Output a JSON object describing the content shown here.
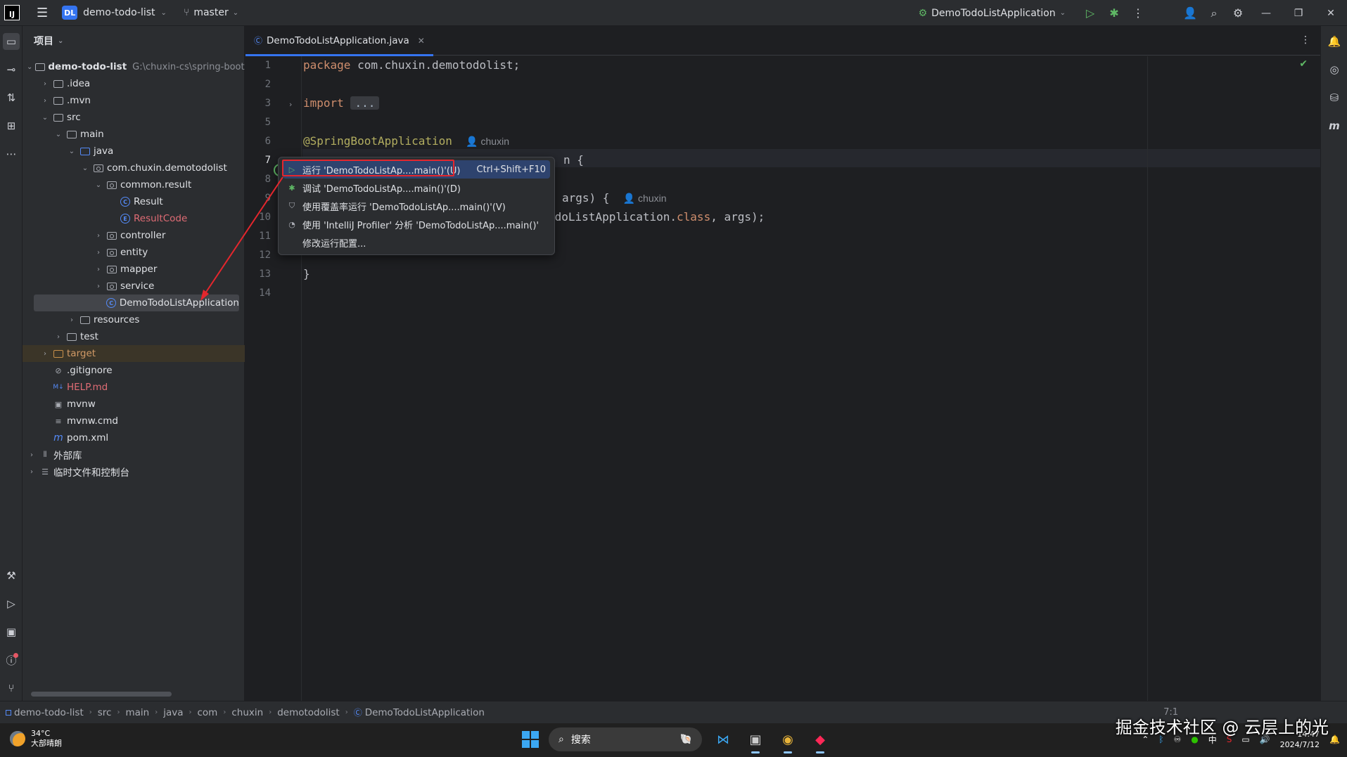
{
  "titlebar": {
    "project_badge": "DL",
    "project_name": "demo-todo-list",
    "branch": "master",
    "run_config": "DemoTodoListApplication"
  },
  "project_panel": {
    "title": "项目",
    "root": "demo-todo-list",
    "root_path": "G:\\chuxin-cs\\spring-boot-",
    "tree": [
      {
        "label": ".idea",
        "depth": 1,
        "arrow": ">",
        "icon": "folder"
      },
      {
        "label": ".mvn",
        "depth": 1,
        "arrow": ">",
        "icon": "folder"
      },
      {
        "label": "src",
        "depth": 1,
        "arrow": "v",
        "icon": "folder"
      },
      {
        "label": "main",
        "depth": 2,
        "arrow": "v",
        "icon": "folder"
      },
      {
        "label": "java",
        "depth": 3,
        "arrow": "v",
        "icon": "folder-blue"
      },
      {
        "label": "com.chuxin.demotodolist",
        "depth": 4,
        "arrow": "v",
        "icon": "package"
      },
      {
        "label": "common.result",
        "depth": 5,
        "arrow": "v",
        "icon": "package"
      },
      {
        "label": "Result",
        "depth": 6,
        "arrow": "",
        "icon": "class"
      },
      {
        "label": "ResultCode",
        "depth": 6,
        "arrow": "",
        "icon": "enum"
      },
      {
        "label": "controller",
        "depth": 5,
        "arrow": ">",
        "icon": "package"
      },
      {
        "label": "entity",
        "depth": 5,
        "arrow": ">",
        "icon": "package"
      },
      {
        "label": "mapper",
        "depth": 5,
        "arrow": ">",
        "icon": "package"
      },
      {
        "label": "service",
        "depth": 5,
        "arrow": ">",
        "icon": "package"
      },
      {
        "label": "DemoTodoListApplication",
        "depth": 5,
        "arrow": "",
        "icon": "spring-class"
      },
      {
        "label": "resources",
        "depth": 3,
        "arrow": ">",
        "icon": "folder"
      },
      {
        "label": "test",
        "depth": 2,
        "arrow": ">",
        "icon": "folder"
      },
      {
        "label": "target",
        "depth": 1,
        "arrow": ">",
        "icon": "folder-orange"
      },
      {
        "label": ".gitignore",
        "depth": 1,
        "arrow": "",
        "icon": "ignore"
      },
      {
        "label": "HELP.md",
        "depth": 1,
        "arrow": "",
        "icon": "markdown"
      },
      {
        "label": "mvnw",
        "depth": 1,
        "arrow": "",
        "icon": "terminal"
      },
      {
        "label": "mvnw.cmd",
        "depth": 1,
        "arrow": "",
        "icon": "text"
      },
      {
        "label": "pom.xml",
        "depth": 1,
        "arrow": "",
        "icon": "maven"
      },
      {
        "label": "外部库",
        "depth": 0,
        "arrow": ">",
        "icon": "library"
      },
      {
        "label": "临时文件和控制台",
        "depth": 0,
        "arrow": ">",
        "icon": "scratch"
      }
    ]
  },
  "editor": {
    "tab_name": "DemoTodoListApplication.java",
    "line_numbers": [
      "1",
      "2",
      "3",
      "5",
      "6",
      "7",
      "8",
      "9",
      "10",
      "11",
      "12",
      "13",
      "14"
    ],
    "code": {
      "l1_kw": "package",
      "l1_rest": " com.chuxin.demotodolist;",
      "l3_kw": "import",
      "l3_fold": "...",
      "l6_ann": "@SpringBootApplication",
      "author": "chuxin",
      "l7_tail": "n {",
      "l9_tail": "args) {",
      "l10_part1": "odoListApplication.",
      "l10_kw": "class",
      "l10_part2": ", args);",
      "l13": "}"
    }
  },
  "popup": {
    "items": [
      {
        "label": "运行 'DemoTodoListAp....main()'(U)",
        "shortcut": "Ctrl+Shift+F10"
      },
      {
        "label": "调试 'DemoTodoListAp....main()'(D)",
        "shortcut": ""
      },
      {
        "label": "使用覆盖率运行 'DemoTodoListAp....main()'(V)",
        "shortcut": ""
      },
      {
        "label": "使用 'IntelliJ Profiler' 分析 'DemoTodoListAp....main()'",
        "shortcut": ""
      },
      {
        "label": "修改运行配置...",
        "shortcut": ""
      }
    ]
  },
  "statusbar": {
    "breadcrumbs": [
      "demo-todo-list",
      "src",
      "main",
      "java",
      "com",
      "chuxin",
      "demotodolist",
      "DemoTodoListApplication"
    ],
    "position": "7:1"
  },
  "taskbar": {
    "temperature": "34°C",
    "weather": "大部晴朗",
    "search_placeholder": "搜索",
    "time": "14:47",
    "date": "2024/7/12",
    "ime": "中"
  },
  "watermark": "掘金技术社区 @ 云层上的光",
  "colors": {
    "accent": "#3574f0",
    "highlight_box": "#e5262d",
    "keyword": "#cf8e6d",
    "annotation": "#b3ae60"
  }
}
